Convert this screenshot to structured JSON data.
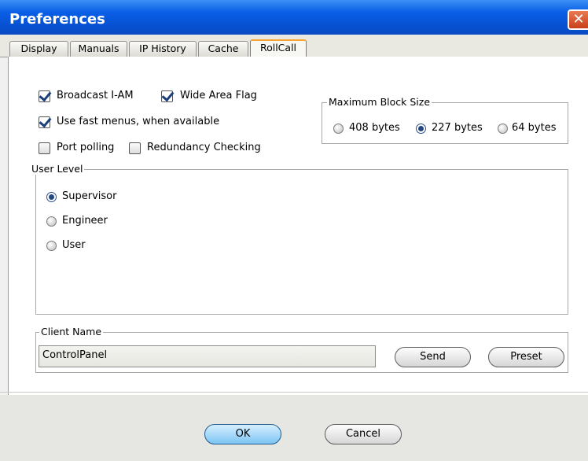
{
  "window": {
    "title": "Preferences",
    "close_glyph": "✕"
  },
  "tabs": [
    {
      "label": "Display"
    },
    {
      "label": "Manuals"
    },
    {
      "label": "IP History"
    },
    {
      "label": "Cache"
    },
    {
      "label": "RollCall",
      "active": true
    }
  ],
  "options": {
    "broadcast_iam": {
      "label": "Broadcast I-AM",
      "checked": true
    },
    "wide_area_flag": {
      "label": "Wide Area Flag",
      "checked": true
    },
    "fast_menus": {
      "label": "Use fast menus, when available",
      "checked": true
    },
    "port_polling": {
      "label": "Port polling",
      "checked": false
    },
    "redundancy_checking": {
      "label": "Redundancy Checking",
      "checked": false
    }
  },
  "block_size": {
    "title": "Maximum Block Size",
    "options": [
      {
        "label": "408 bytes",
        "selected": false
      },
      {
        "label": "227 bytes",
        "selected": true
      },
      {
        "label": "64 bytes",
        "selected": false
      }
    ]
  },
  "user_level": {
    "title": "User Level",
    "options": [
      {
        "label": "Supervisor",
        "selected": true
      },
      {
        "label": "Engineer",
        "selected": false
      },
      {
        "label": "User",
        "selected": false
      }
    ]
  },
  "client": {
    "title": "Client Name",
    "value": "ControlPanel",
    "send_label": "Send",
    "preset_label": "Preset"
  },
  "footer": {
    "ok_label": "OK",
    "cancel_label": "Cancel"
  },
  "colors": {
    "title_bar": "#0a5fe6",
    "active_tab_accent": "#f5a530",
    "ok_button": "#7cc4f3"
  }
}
